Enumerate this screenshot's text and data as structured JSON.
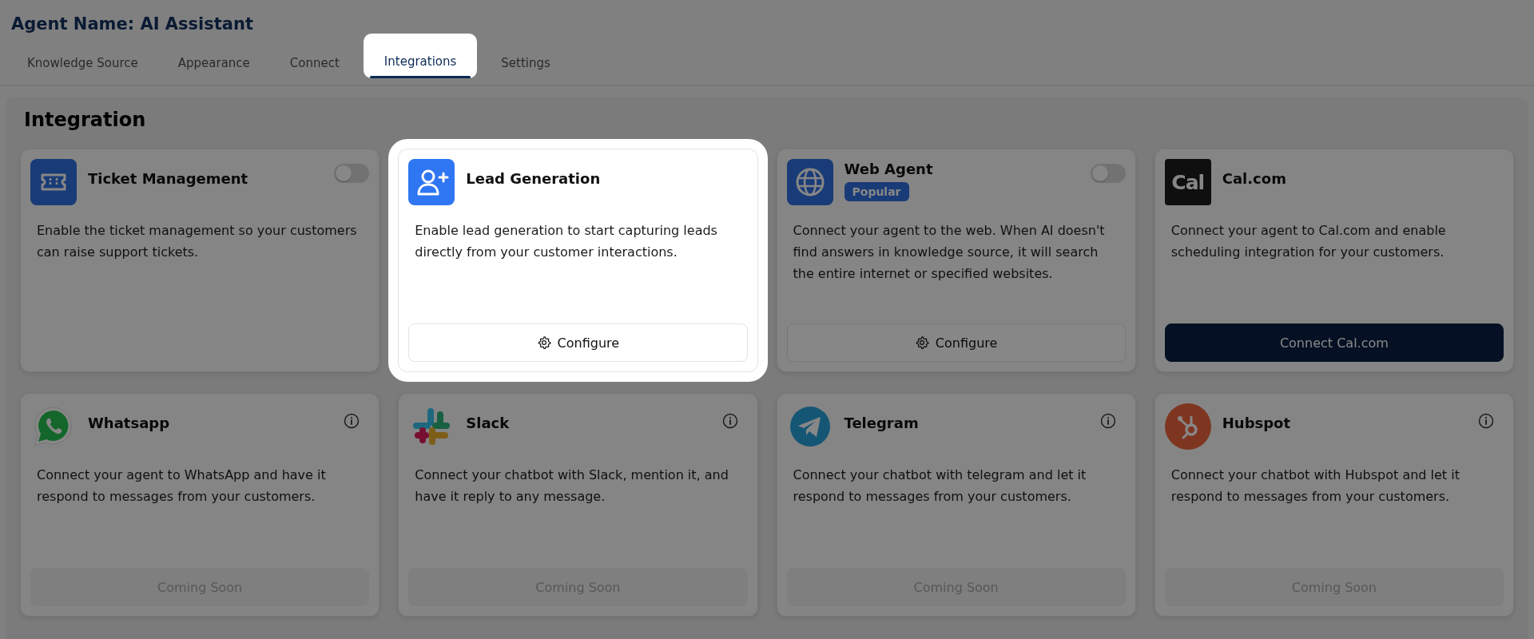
{
  "agent_title": "Agent Name: AI Assistant",
  "tabs": [
    {
      "label": "Knowledge Source",
      "selected": false,
      "highlighted": false
    },
    {
      "label": "Appearance",
      "selected": false,
      "highlighted": false
    },
    {
      "label": "Connect",
      "selected": false,
      "highlighted": false
    },
    {
      "label": "Integrations",
      "selected": true,
      "highlighted": true
    },
    {
      "label": "Settings",
      "selected": false,
      "highlighted": false
    }
  ],
  "section_title": "Integration",
  "cards": [
    {
      "title": "Ticket Management",
      "description": "Enable the ticket management so your customers can raise support tickets.",
      "highlighted": false,
      "toggle": {
        "on": false
      }
    },
    {
      "title": "Lead Generation",
      "description": "Enable lead generation to start capturing leads directly from your customer interactions.",
      "highlighted": true,
      "button": {
        "kind": "configure",
        "label": "Configure"
      }
    },
    {
      "title": "Web Agent",
      "badge": "Popular",
      "description": "Connect your agent to the web. When AI doesn't find answers in knowledge source, it will search the entire internet or specified websites.",
      "highlighted": false,
      "toggle": {
        "on": false
      },
      "button": {
        "kind": "configure",
        "label": "Configure"
      }
    },
    {
      "logo_text": "Cal",
      "title": "Cal.com",
      "description": "Connect your agent to Cal.com and enable scheduling integration for your customers.",
      "highlighted": false,
      "button": {
        "kind": "primary",
        "label": "Connect Cal.com"
      }
    },
    {
      "title": "Whatsapp",
      "info": true,
      "description": "Connect your agent to WhatsApp and have it respond to messages from your customers.",
      "highlighted": false,
      "button": {
        "kind": "disabled",
        "label": "Coming Soon"
      }
    },
    {
      "title": "Slack",
      "info": true,
      "description": "Connect your chatbot with Slack, mention it, and have it reply to any message.",
      "highlighted": false,
      "button": {
        "kind": "disabled",
        "label": "Coming Soon"
      }
    },
    {
      "title": "Telegram",
      "info": true,
      "description": "Connect your chatbot with telegram and let it respond to messages from your customers.",
      "highlighted": false,
      "button": {
        "kind": "disabled",
        "label": "Coming Soon"
      }
    },
    {
      "title": "Hubspot",
      "info": true,
      "description": "Connect your chatbot with Hubspot and let it respond to messages from your customers.",
      "highlighted": false,
      "button": {
        "kind": "disabled",
        "label": "Coming Soon"
      }
    }
  ]
}
